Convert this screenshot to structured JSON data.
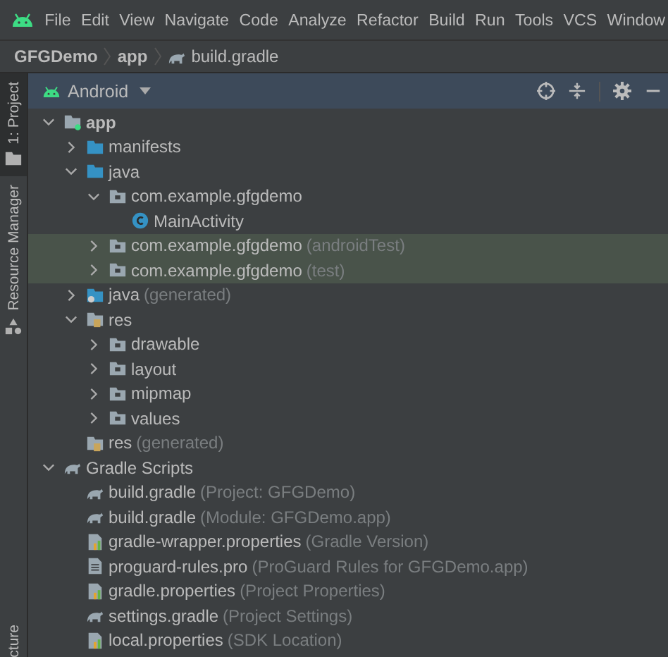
{
  "menu": [
    "File",
    "Edit",
    "View",
    "Navigate",
    "Code",
    "Analyze",
    "Refactor",
    "Build",
    "Run",
    "Tools",
    "VCS",
    "Window"
  ],
  "breadcrumb": [
    {
      "label": "GFGDemo",
      "kind": "project"
    },
    {
      "label": "app",
      "kind": "module"
    },
    {
      "label": "build.gradle",
      "kind": "gradle"
    }
  ],
  "side_tabs": [
    {
      "label": "1: Project",
      "selected": true,
      "kind": "project"
    },
    {
      "label": "Resource Manager",
      "selected": false,
      "kind": "resources"
    },
    {
      "label": "cture",
      "selected": false,
      "kind": "plain"
    }
  ],
  "panel": {
    "view": "Android"
  },
  "tree": [
    {
      "label": "app",
      "kind": "module",
      "expanded": true,
      "highlighted": false,
      "children": [
        {
          "label": "manifests",
          "kind": "folder",
          "expanded": false,
          "highlighted": false
        },
        {
          "label": "java",
          "kind": "folder",
          "expanded": true,
          "highlighted": false,
          "children": [
            {
              "label": "com.example.gfgdemo",
              "kind": "package",
              "expanded": true,
              "highlighted": false,
              "children": [
                {
                  "label": "MainActivity",
                  "kind": "class",
                  "highlighted": false
                }
              ]
            },
            {
              "label": "com.example.gfgdemo",
              "note": "(androidTest)",
              "kind": "package",
              "expanded": false,
              "highlighted": true
            },
            {
              "label": "com.example.gfgdemo",
              "note": "(test)",
              "kind": "package",
              "expanded": false,
              "highlighted": true
            }
          ]
        },
        {
          "label": "java",
          "note": "(generated)",
          "kind": "generated",
          "expanded": false,
          "highlighted": false
        },
        {
          "label": "res",
          "kind": "res",
          "expanded": true,
          "highlighted": false,
          "children": [
            {
              "label": "drawable",
              "kind": "package",
              "expanded": false,
              "highlighted": false
            },
            {
              "label": "layout",
              "kind": "package",
              "expanded": false,
              "highlighted": false
            },
            {
              "label": "mipmap",
              "kind": "package",
              "expanded": false,
              "highlighted": false
            },
            {
              "label": "values",
              "kind": "package",
              "expanded": false,
              "highlighted": false
            }
          ]
        },
        {
          "label": "res",
          "note": "(generated)",
          "kind": "res",
          "highlighted": false
        }
      ]
    },
    {
      "label": "Gradle Scripts",
      "kind": "gradle",
      "expanded": true,
      "highlighted": false,
      "children": [
        {
          "label": "build.gradle",
          "note": "(Project: GFGDemo)",
          "kind": "gradle",
          "highlighted": false
        },
        {
          "label": "build.gradle",
          "note": "(Module: GFGDemo.app)",
          "kind": "gradle",
          "highlighted": false
        },
        {
          "label": "gradle-wrapper.properties",
          "note": "(Gradle Version)",
          "kind": "properties",
          "highlighted": false
        },
        {
          "label": "proguard-rules.pro",
          "note": "(ProGuard Rules for GFGDemo.app)",
          "kind": "file",
          "highlighted": false
        },
        {
          "label": "gradle.properties",
          "note": "(Project Properties)",
          "kind": "properties",
          "highlighted": false
        },
        {
          "label": "settings.gradle",
          "note": "(Project Settings)",
          "kind": "gradle",
          "highlighted": false
        },
        {
          "label": "local.properties",
          "note": "(SDK Location)",
          "kind": "properties",
          "highlighted": false
        }
      ]
    }
  ]
}
